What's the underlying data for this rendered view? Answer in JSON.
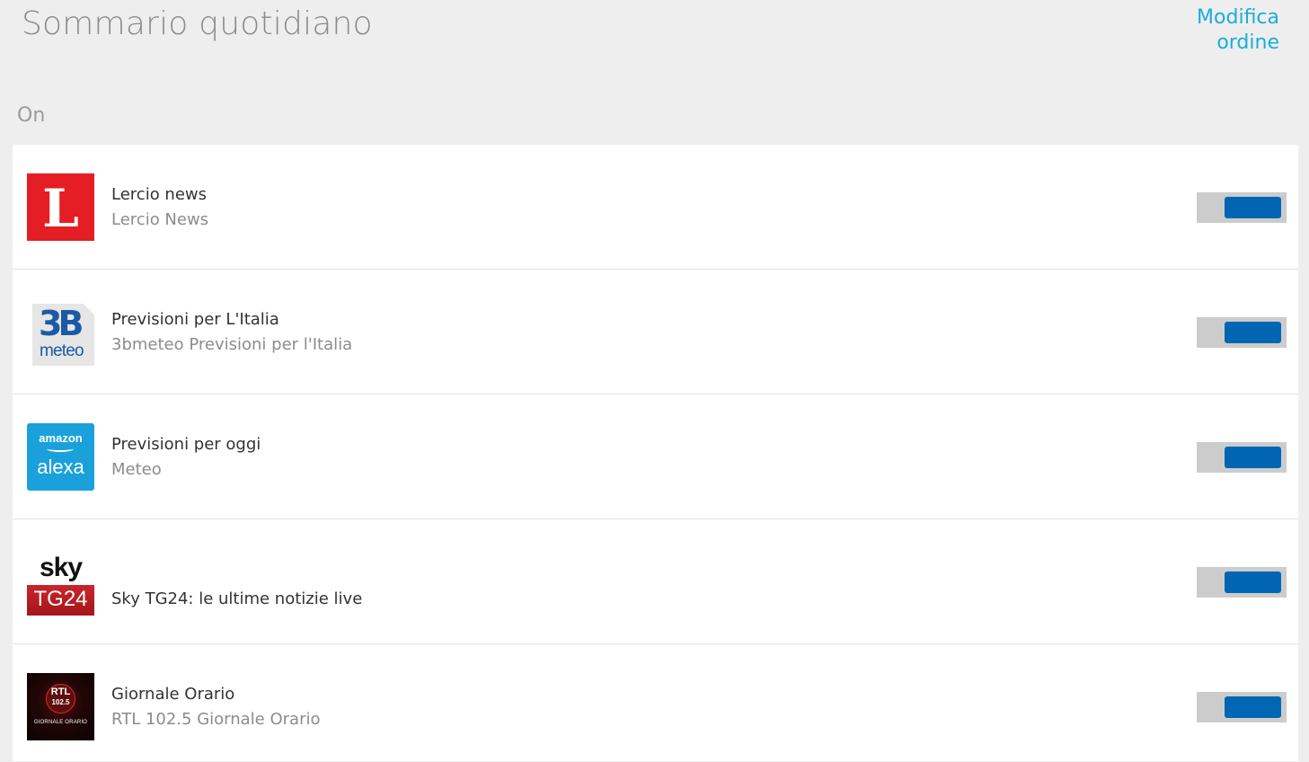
{
  "header": {
    "title": "Sommario quotidiano",
    "edit_order_label": "Modifica ordine"
  },
  "section": {
    "label": "On"
  },
  "accent_color": "#0066b3",
  "link_color": "#1aaeda",
  "items": [
    {
      "title": "Lercio news",
      "subtitle": "Lercio News",
      "logo": {
        "icon": "lercio-logo-icon",
        "text": "L"
      },
      "enabled": true
    },
    {
      "title": "Previsioni per L'Italia",
      "subtitle": "3bmeteo Previsioni per l'Italia",
      "logo": {
        "icon": "3bmeteo-logo-icon",
        "text_big": "3B",
        "text_small": "meteo"
      },
      "enabled": true
    },
    {
      "title": "Previsioni per oggi",
      "subtitle": "Meteo",
      "logo": {
        "icon": "amazon-alexa-logo-icon",
        "text_top": "amazon",
        "text_bottom": "alexa"
      },
      "enabled": true
    },
    {
      "title": "Sky TG24: le ultime notizie live",
      "subtitle": "",
      "logo": {
        "icon": "sky-tg24-logo-icon",
        "text_top": "sky",
        "text_bottom": "TG24"
      },
      "enabled": true
    },
    {
      "title": "Giornale Orario",
      "subtitle": "RTL 102.5 Giornale Orario",
      "logo": {
        "icon": "rtl-1025-logo-icon",
        "text_top": "RTL",
        "text_mid": "102.5",
        "text_caption": "GIORNALE ORARIO"
      },
      "enabled": true
    }
  ]
}
